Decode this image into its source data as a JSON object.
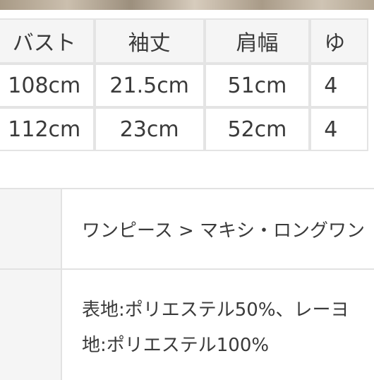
{
  "size_table": {
    "headers": [
      "バスト",
      "袖丈",
      "肩幅",
      "ゆ"
    ],
    "rows": [
      [
        "108cm",
        "21.5cm",
        "51cm",
        "4"
      ],
      [
        "112cm",
        "23cm",
        "52cm",
        "4"
      ]
    ]
  },
  "product_info": {
    "category": "ワンピース > マキシ・ロングワン",
    "material_line1": "表地:ポリエステル50%、レーヨ",
    "material_line2": "地:ポリエステル100%"
  }
}
